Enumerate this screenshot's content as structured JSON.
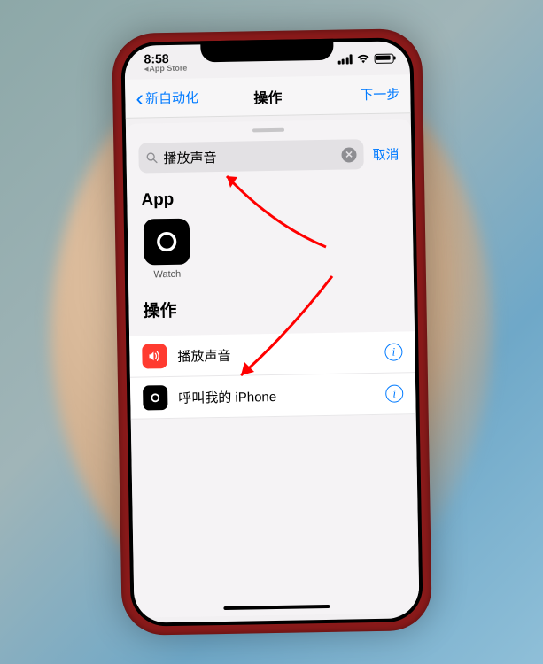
{
  "status": {
    "time": "8:58",
    "back_app": "App Store"
  },
  "nav": {
    "back": "新自动化",
    "title": "操作",
    "next": "下一步"
  },
  "search": {
    "value": "播放声音",
    "cancel": "取消"
  },
  "sections": {
    "app_header": "App",
    "actions_header": "操作"
  },
  "apps": [
    {
      "label": "Watch"
    }
  ],
  "actions": [
    {
      "label": "播放声音",
      "icon": "speaker",
      "color": "red"
    },
    {
      "label": "呼叫我的 iPhone",
      "icon": "watch",
      "color": "black"
    }
  ],
  "colors": {
    "ios_blue": "#007aff",
    "ios_red": "#ff3b30",
    "arrow_red": "#ff0000"
  }
}
